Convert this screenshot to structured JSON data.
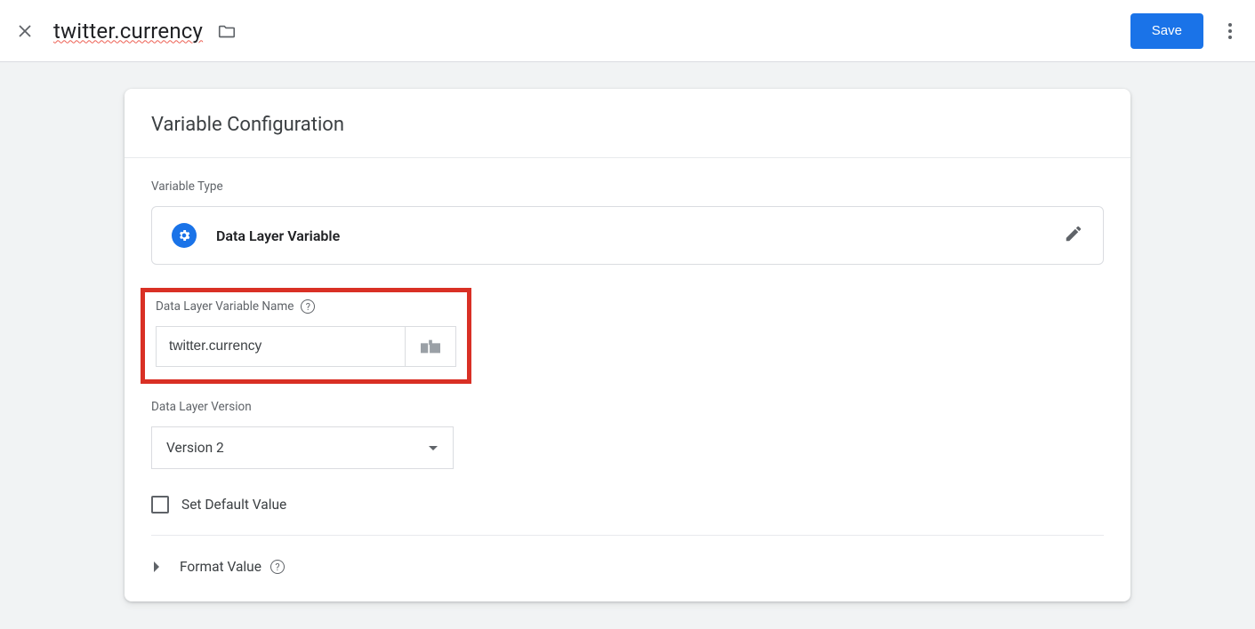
{
  "header": {
    "title": "twitter.currency",
    "save_label": "Save"
  },
  "card": {
    "title": "Variable Configuration",
    "variable_type_label": "Variable Type",
    "variable_type_value": "Data Layer Variable",
    "name_field": {
      "label": "Data Layer Variable Name",
      "value": "twitter.currency"
    },
    "version_field": {
      "label": "Data Layer Version",
      "value": "Version 2"
    },
    "default_checkbox_label": "Set Default Value",
    "format_label": "Format Value"
  }
}
